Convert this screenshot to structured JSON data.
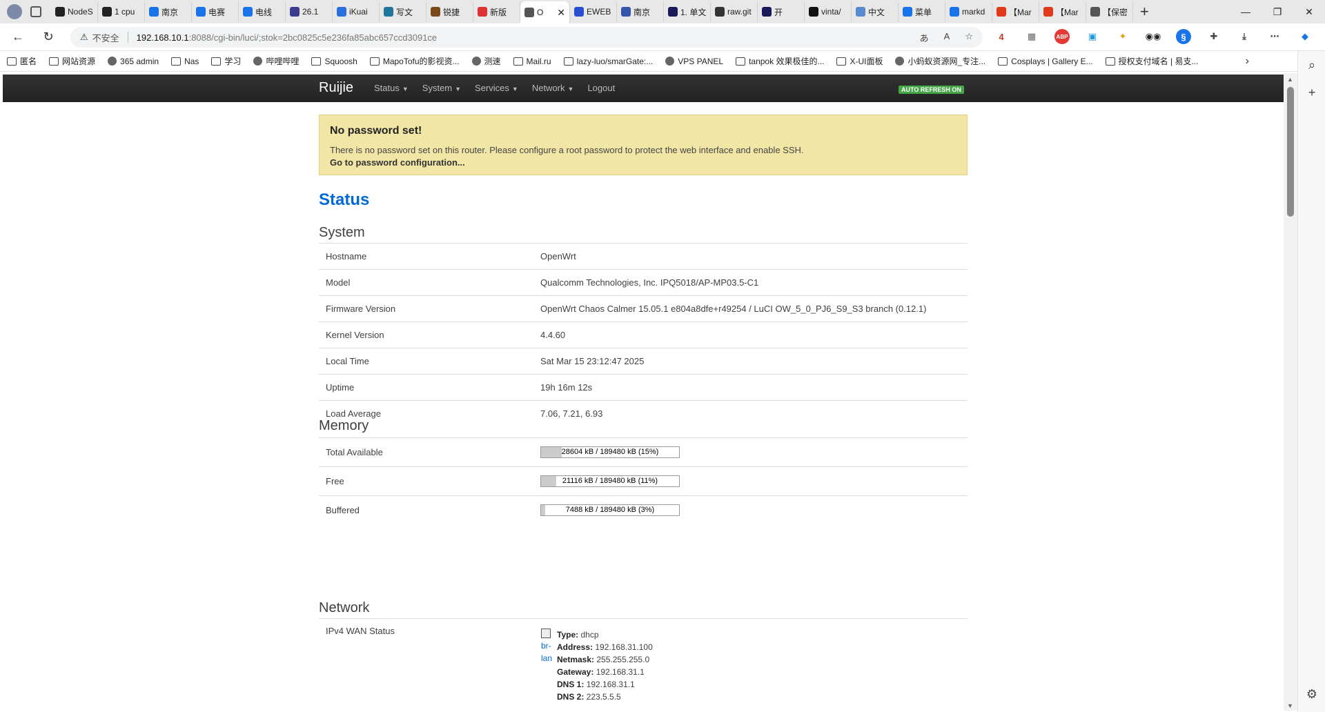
{
  "browser": {
    "tabs": [
      {
        "label": "NodeS",
        "color": "#222"
      },
      {
        "label": "1 cpu",
        "color": "#222"
      },
      {
        "label": "南京",
        "color": "#1a73e8"
      },
      {
        "label": "电赛",
        "color": "#1a73e8"
      },
      {
        "label": "电线",
        "color": "#1a73e8"
      },
      {
        "label": "26.1",
        "color": "#3b3b8f"
      },
      {
        "label": "iKuai",
        "color": "#2a6fdb"
      },
      {
        "label": "写文",
        "color": "#21759b"
      },
      {
        "label": "锐捷",
        "color": "#7a4a1a"
      },
      {
        "label": "新版",
        "color": "#d33"
      },
      {
        "label": "O",
        "color": "#555",
        "active": true
      },
      {
        "label": "EWEB",
        "color": "#2a4fd0"
      },
      {
        "label": "南京",
        "color": "#3355aa"
      },
      {
        "label": "1. 单文",
        "color": "#1a1a5a"
      },
      {
        "label": "raw.git",
        "color": "#333"
      },
      {
        "label": "开",
        "color": "#1a1a5a"
      },
      {
        "label": "vinta/",
        "color": "#111"
      },
      {
        "label": "中文",
        "color": "#5a8ad0"
      },
      {
        "label": "菜单",
        "color": "#1a73e8"
      },
      {
        "label": "markd",
        "color": "#1a73e8"
      },
      {
        "label": "【Mar",
        "color": "#e03a1a"
      },
      {
        "label": "【Mar",
        "color": "#e03a1a"
      },
      {
        "label": "【保密",
        "color": "#555"
      }
    ],
    "address": {
      "warning_label": "不安全",
      "host": "192.168.10.1",
      "path": ":8088/cgi-bin/luci/;stok=2bc0825c5e236fa85abc657ccd3091ce"
    },
    "extension_badge": "4",
    "bookmarks": [
      "匿名",
      "网站资源",
      "365 admin",
      "Nas",
      "学习",
      "哔哩哔哩",
      "Squoosh",
      "MapoTofu的影视资...",
      "测速",
      "Mail.ru",
      "lazy-luo/smarGate:...",
      "VPS PANEL",
      "tanpok 效果极佳的...",
      "X-UI面板",
      "小蚂蚁资源网_专注...",
      "Cosplays | Gallery E...",
      "授权支付域名 | 易支..."
    ]
  },
  "luci": {
    "brand": "Ruijie",
    "menu": [
      "Status",
      "System",
      "Services",
      "Network",
      "Logout"
    ],
    "auto_refresh": "AUTO REFRESH ON",
    "alert": {
      "title": "No password set!",
      "body": "There is no password set on this router. Please configure a root password to protect the web interface and enable SSH.",
      "link": "Go to password configuration..."
    },
    "page_title": "Status",
    "system": {
      "heading": "System",
      "rows": [
        {
          "k": "Hostname",
          "v": "OpenWrt"
        },
        {
          "k": "Model",
          "v": "Qualcomm Technologies, Inc. IPQ5018/AP-MP03.5-C1"
        },
        {
          "k": "Firmware Version",
          "v": "OpenWrt Chaos Calmer 15.05.1 e804a8dfe+r49254 / LuCI OW_5_0_PJ6_S9_S3 branch (0.12.1)"
        },
        {
          "k": "Kernel Version",
          "v": "4.4.60"
        },
        {
          "k": "Local Time",
          "v": "Sat Mar 15 23:12:47 2025"
        },
        {
          "k": "Uptime",
          "v": "19h 16m 12s"
        },
        {
          "k": "Load Average",
          "v": "7.06, 7.21, 6.93"
        }
      ]
    },
    "memory": {
      "heading": "Memory",
      "rows": [
        {
          "k": "Total Available",
          "v": "28604 kB / 189480 kB (15%)",
          "pct": 15
        },
        {
          "k": "Free",
          "v": "21116 kB / 189480 kB (11%)",
          "pct": 11
        },
        {
          "k": "Buffered",
          "v": "7488 kB / 189480 kB (3%)",
          "pct": 3
        }
      ]
    },
    "network": {
      "heading": "Network",
      "wan_label": "IPv4 WAN Status",
      "iface": "br-lan",
      "details": [
        {
          "k": "Type:",
          "v": "dhcp"
        },
        {
          "k": "Address:",
          "v": "192.168.31.100"
        },
        {
          "k": "Netmask:",
          "v": "255.255.255.0"
        },
        {
          "k": "Gateway:",
          "v": "192.168.31.1"
        },
        {
          "k": "DNS 1:",
          "v": "192.168.31.1"
        },
        {
          "k": "DNS 2:",
          "v": "223.5.5.5"
        }
      ]
    }
  }
}
